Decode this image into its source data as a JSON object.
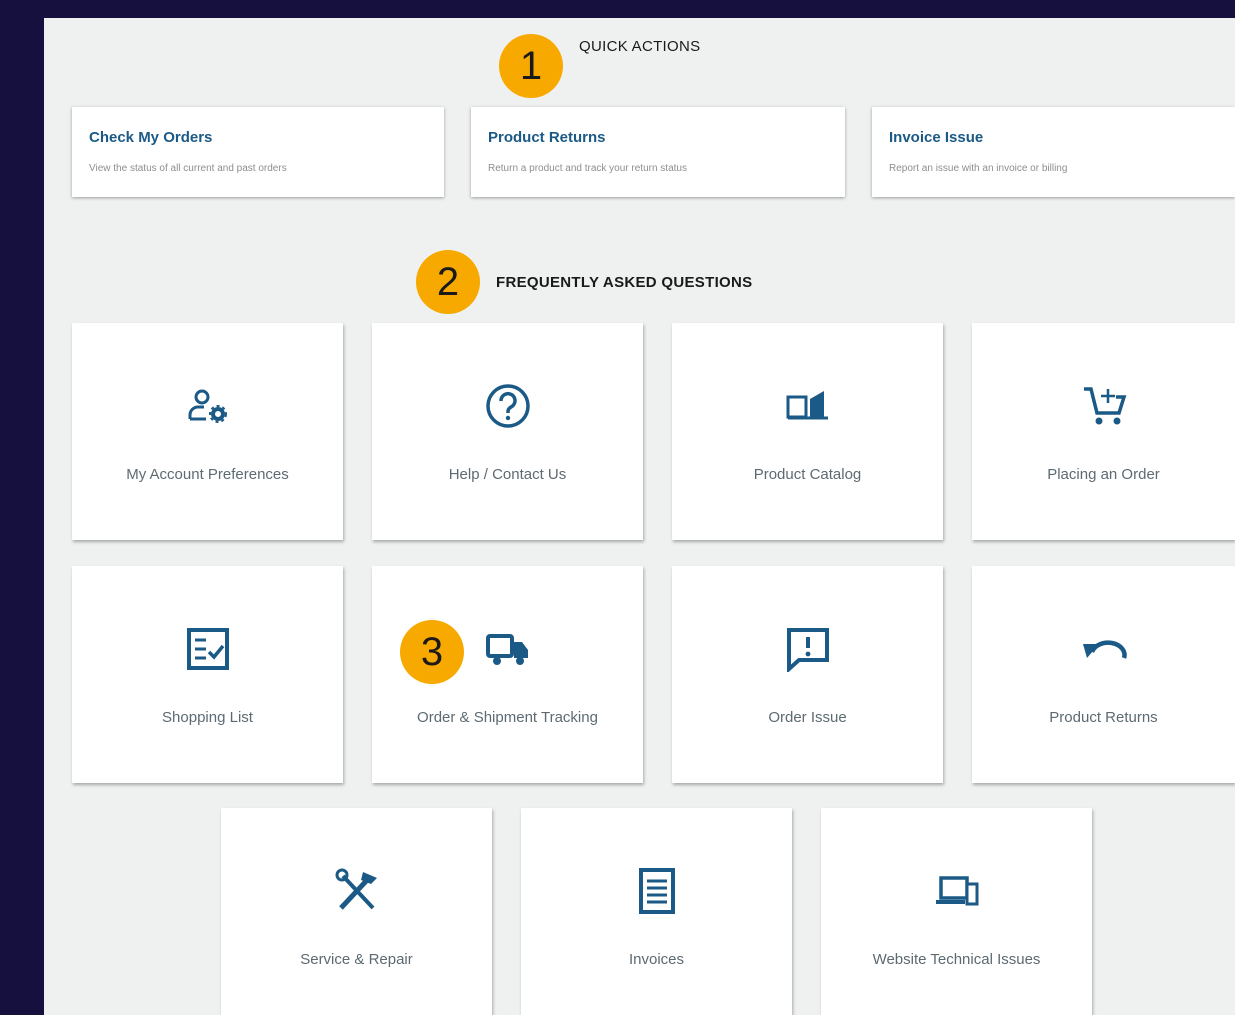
{
  "quick_actions": {
    "title": "QUICK ACTIONS",
    "cards": [
      {
        "title": "Check My Orders",
        "desc": "View the status of all current and past orders"
      },
      {
        "title": "Product Returns",
        "desc": "Return a product and track your return status"
      },
      {
        "title": "Invoice Issue",
        "desc": "Report an issue with an invoice or billing"
      }
    ]
  },
  "faq": {
    "title": "FREQUENTLY ASKED QUESTIONS",
    "items": [
      {
        "label": "My Account Preferences",
        "icon": "account-settings-icon"
      },
      {
        "label": "Help / Contact Us",
        "icon": "help-circle-icon"
      },
      {
        "label": "Product Catalog",
        "icon": "catalog-book-icon"
      },
      {
        "label": "Placing an Order",
        "icon": "cart-add-icon"
      },
      {
        "label": "Shopping List",
        "icon": "checklist-icon"
      },
      {
        "label": "Order & Shipment Tracking",
        "icon": "truck-icon"
      },
      {
        "label": "Order Issue",
        "icon": "alert-message-icon"
      },
      {
        "label": "Product Returns",
        "icon": "return-arrow-icon"
      },
      {
        "label": "Service & Repair",
        "icon": "tools-icon"
      },
      {
        "label": "Invoices",
        "icon": "invoice-document-icon"
      },
      {
        "label": "Website Technical Issues",
        "icon": "devices-icon"
      }
    ]
  },
  "callouts": [
    "1",
    "2",
    "3"
  ],
  "colors": {
    "accent": "#1b5a86",
    "badge": "#f8a900",
    "frame": "#16103f"
  }
}
